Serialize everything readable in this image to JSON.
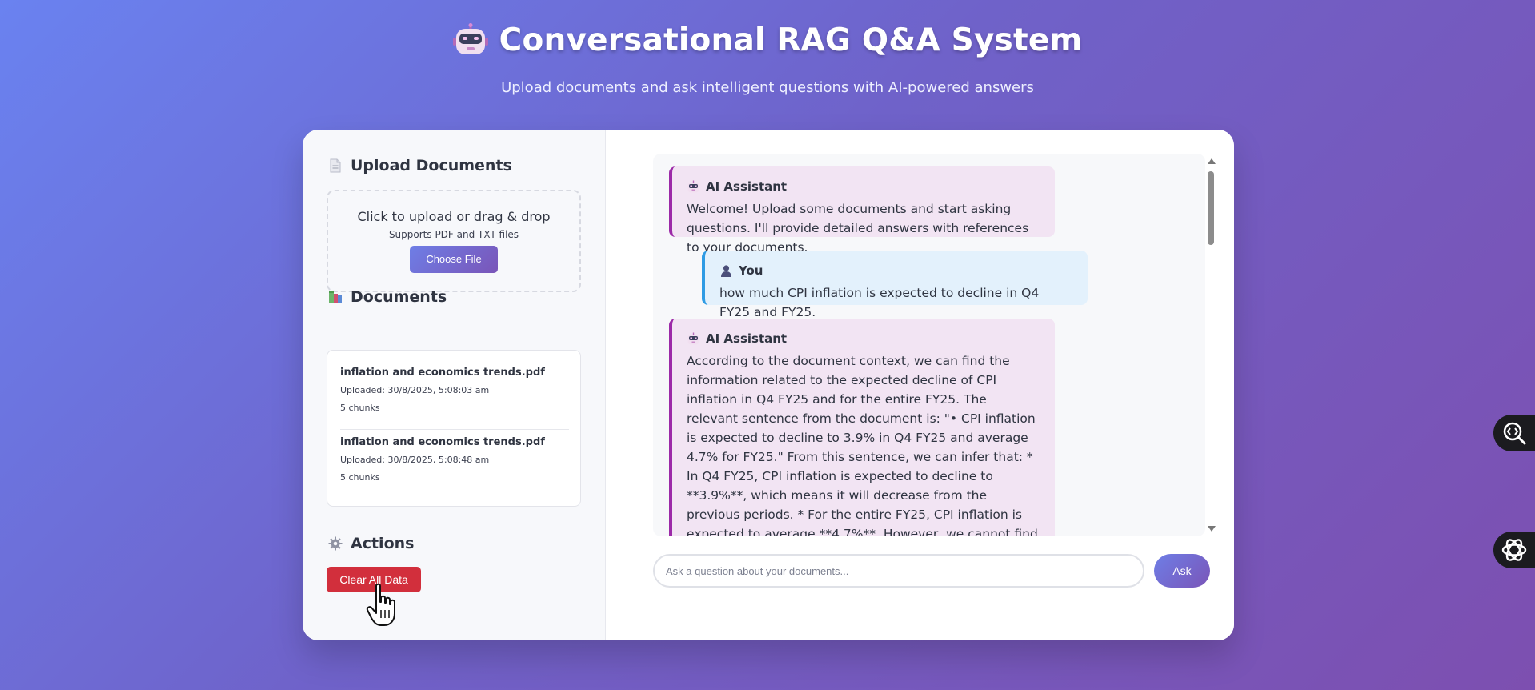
{
  "header": {
    "title": "Conversational RAG Q&A System",
    "subtitle": "Upload documents and ask intelligent questions with AI-powered answers"
  },
  "sidebar": {
    "upload": {
      "title": "Upload Documents",
      "primary": "Click to upload or drag & drop",
      "secondary": "Supports PDF and TXT files",
      "button": "Choose File"
    },
    "documents": {
      "title": "Documents",
      "items": [
        {
          "name": "inflation and economics trends.pdf",
          "uploaded": "Uploaded: 30/8/2025, 5:08:03 am",
          "chunks": "5 chunks"
        },
        {
          "name": "inflation and economics trends.pdf",
          "uploaded": "Uploaded: 30/8/2025, 5:08:48 am",
          "chunks": "5 chunks"
        }
      ]
    },
    "actions": {
      "title": "Actions",
      "clear_button": "Clear All Data"
    }
  },
  "chat": {
    "messages": [
      {
        "role": "ai",
        "sender": "AI Assistant",
        "text": "Welcome! Upload some documents and start asking questions. I'll provide detailed answers with references to your documents."
      },
      {
        "role": "user",
        "sender": "You",
        "text": "how much CPI inflation is expected to decline in Q4 FY25 and FY25."
      },
      {
        "role": "ai",
        "sender": "AI Assistant",
        "text": "According to the document context, we can find the information related to the expected decline of CPI inflation in Q4 FY25 and for the entire FY25. The relevant sentence from the document is: \"• CPI inflation is expected to decline to 3.9% in Q4 FY25 and average 4.7% for FY25.\" From this sentence, we can infer that: * In Q4 FY25, CPI inflation is expected to decline to **3.9%**, which means it will decrease from the previous periods. * For the entire FY25, CPI inflation is expected to average **4.7%**. However, we cannot find any information in the document about how much CPI inflation is expected to"
      }
    ],
    "input_placeholder": "Ask a question about your documents...",
    "ask_button": "Ask"
  },
  "colors": {
    "accent_gradient_start": "#6e7ee6",
    "accent_gradient_end": "#7a55b8",
    "ai_border": "#9c2aa8",
    "user_border": "#2e9be4",
    "danger": "#d22f3c"
  },
  "icons": {
    "title": "robot-icon",
    "upload": "document-icon",
    "documents": "books-icon",
    "actions": "gear-icon",
    "ai_sender": "robot-icon",
    "user_sender": "person-icon"
  }
}
